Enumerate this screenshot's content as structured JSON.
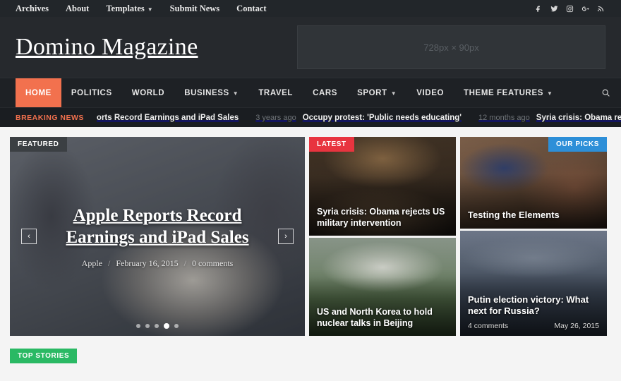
{
  "topbar": {
    "links": [
      {
        "label": "Archives",
        "has_caret": false
      },
      {
        "label": "About",
        "has_caret": false
      },
      {
        "label": "Templates",
        "has_caret": true
      },
      {
        "label": "Submit News",
        "has_caret": false
      },
      {
        "label": "Contact",
        "has_caret": false
      }
    ],
    "social": [
      {
        "name": "facebook-icon"
      },
      {
        "name": "twitter-icon"
      },
      {
        "name": "instagram-icon"
      },
      {
        "name": "google-plus-icon"
      },
      {
        "name": "rss-icon"
      }
    ]
  },
  "header": {
    "logo": "Domino Magazine",
    "ad_placeholder": "728px × 90px"
  },
  "mainnav": {
    "items": [
      {
        "label": "HOME",
        "active": true,
        "has_caret": false
      },
      {
        "label": "POLITICS",
        "active": false,
        "has_caret": false
      },
      {
        "label": "WORLD",
        "active": false,
        "has_caret": false
      },
      {
        "label": "BUSINESS",
        "active": false,
        "has_caret": true
      },
      {
        "label": "TRAVEL",
        "active": false,
        "has_caret": false
      },
      {
        "label": "CARS",
        "active": false,
        "has_caret": false
      },
      {
        "label": "SPORT",
        "active": false,
        "has_caret": true
      },
      {
        "label": "VIDEO",
        "active": false,
        "has_caret": false
      },
      {
        "label": "THEME FEATURES",
        "active": false,
        "has_caret": true
      }
    ],
    "search_icon": "search-icon",
    "accent_color": "#f2714e"
  },
  "breaking": {
    "label": "BREAKING NEWS",
    "items": [
      {
        "time": "",
        "title": "orts Record Earnings and iPad Sales"
      },
      {
        "time": "3 years ago",
        "title": "Occupy protest: 'Public needs educating'"
      },
      {
        "time": "12 months ago",
        "title": "Syria crisis: Obama rejects US military intervention"
      }
    ],
    "label_color": "#f2714e"
  },
  "featured": {
    "badge": "FEATURED",
    "badge_color": "#3b3f43",
    "slide": {
      "title": "Apple Reports Record Earnings and iPad Sales",
      "category": "Apple",
      "date": "February 16, 2015",
      "comments": "0 comments"
    },
    "prev_label": "‹",
    "next_label": "›",
    "dots_total": 5,
    "dot_active_index": 3
  },
  "latest": {
    "badge": "LATEST",
    "badge_color": "#e8343f",
    "items": [
      {
        "title": "Syria crisis: Obama rejects US military intervention"
      },
      {
        "title": "US and North Korea to hold nuclear talks in Beijing"
      }
    ]
  },
  "picks": {
    "badge": "OUR PICKS",
    "badge_color": "#2d8fd8",
    "items": [
      {
        "title": "Testing the Elements",
        "comments": "",
        "date": ""
      },
      {
        "title": "Putin election victory: What next for Russia?",
        "comments": "4 comments",
        "date": "May 26, 2015"
      }
    ]
  },
  "top_stories": {
    "badge": "TOP STORIES",
    "badge_color": "#2ab964"
  }
}
